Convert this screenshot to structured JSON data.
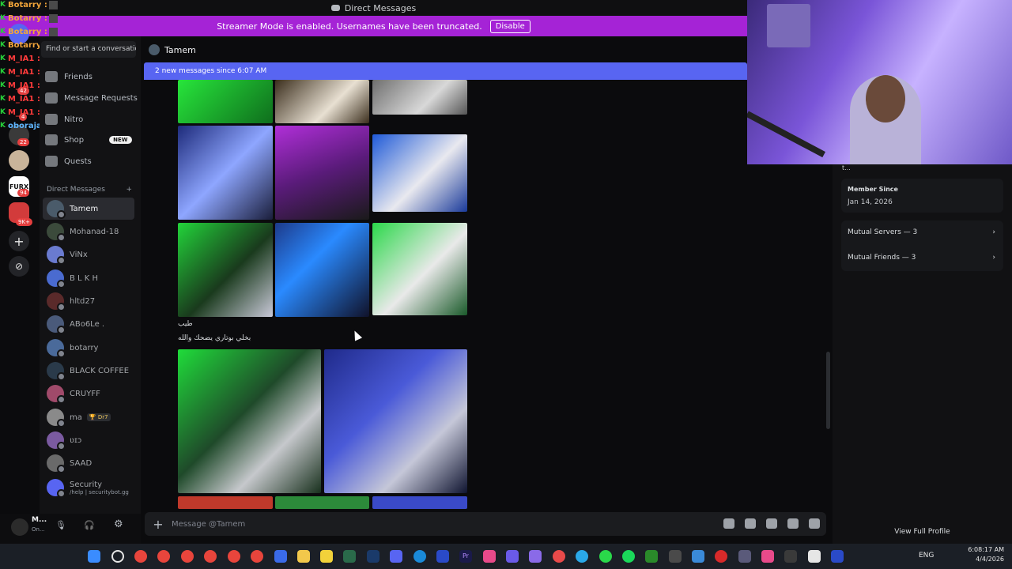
{
  "window": {
    "title": "Direct Messages"
  },
  "banner": {
    "text": "Streamer Mode is enabled. Usernames have been truncated.",
    "button": "Disable"
  },
  "overlay": {
    "lines": [
      {
        "user": "Botarry :",
        "color": "#f2a53a"
      },
      {
        "user": "Botarry :",
        "color": "#f2a53a"
      },
      {
        "user": "Botarry :",
        "color": "#f2a53a"
      },
      {
        "user": "Botarry :",
        "color": "#f2a53a"
      },
      {
        "user": "M_IA1 :",
        "color": "#ff3b3b"
      },
      {
        "user": "M_IA1 :",
        "color": "#ff3b3b"
      },
      {
        "user": "M_IA1 :",
        "color": "#ff3b3b"
      },
      {
        "user": "M_IA1 :",
        "color": "#ff3b3b"
      },
      {
        "user": "M_IA1 :",
        "color": "#ff3b3b"
      },
      {
        "user": "M_IA1 :",
        "color": "#ff3b3b"
      },
      {
        "user": "oboraja : نح سا",
        "color": "#5fb6ff"
      }
    ]
  },
  "rail": {
    "badges": [
      "42",
      "4",
      "22",
      "94",
      "9K+"
    ],
    "server_label": "FURX"
  },
  "sidebar": {
    "search_placeholder": "Find or start a conversation",
    "nav": [
      {
        "label": "Friends",
        "icon": "friends-icon"
      },
      {
        "label": "Message Requests",
        "icon": "mail-icon"
      },
      {
        "label": "Nitro",
        "icon": "nitro-icon"
      },
      {
        "label": "Shop",
        "icon": "shop-icon",
        "tag": "NEW"
      },
      {
        "label": "Quests",
        "icon": "quests-icon"
      }
    ],
    "dm_header": "Direct Messages",
    "dm_add": "+",
    "dms": [
      {
        "name": "Tamem",
        "color": "#4a5b6a",
        "selected": true
      },
      {
        "name": "Mohanad-18",
        "color": "#3b4a3b"
      },
      {
        "name": "ViNx",
        "color": "#6a7bd0"
      },
      {
        "name": "B L K H",
        "color": "#4a6bd0"
      },
      {
        "name": "hltd27",
        "color": "#5a2a2a"
      },
      {
        "name": "ABo6Le .",
        "color": "#4a5a7a"
      },
      {
        "name": "botarry",
        "color": "#4a6a9a"
      },
      {
        "name": "BLACK COFFEE",
        "color": "#2a3a4a"
      },
      {
        "name": "CRUYFF",
        "color": "#a04a6a"
      },
      {
        "name": "ma",
        "color": "#8a8a8a",
        "tag": "🏆 Dr7"
      },
      {
        "name": "ʋɪɔ",
        "color": "#7a5aa0"
      },
      {
        "name": "SAAD",
        "color": "#6a6a6a"
      },
      {
        "name": "Security",
        "color": "#5865f2",
        "sub": "/help | securitybot.gg"
      }
    ]
  },
  "user_panel": {
    "name": "M...",
    "status": "On..."
  },
  "chat": {
    "recipient": "Tamem",
    "new_messages": "2 new messages since 6:07 AM",
    "messages": [
      {
        "line1": "طيب",
        "line2": "بخلي بوتاري يضحك والله"
      }
    ],
    "composer_placeholder": "Message @Tamem"
  },
  "profile": {
    "truncated": "t...",
    "member_since_label": "Member Since",
    "member_since_value": "Jan 14, 2026",
    "mutual_servers": "Mutual Servers — 3",
    "mutual_friends": "Mutual Friends — 3",
    "view_full": "View Full Profile"
  },
  "taskbar": {
    "lang": "ENG",
    "time": "6:08:17 AM",
    "date": "4/4/2026"
  },
  "colors": {
    "accent": "#5865f2",
    "streamer": "#a523d6",
    "green": "#26d13a"
  }
}
